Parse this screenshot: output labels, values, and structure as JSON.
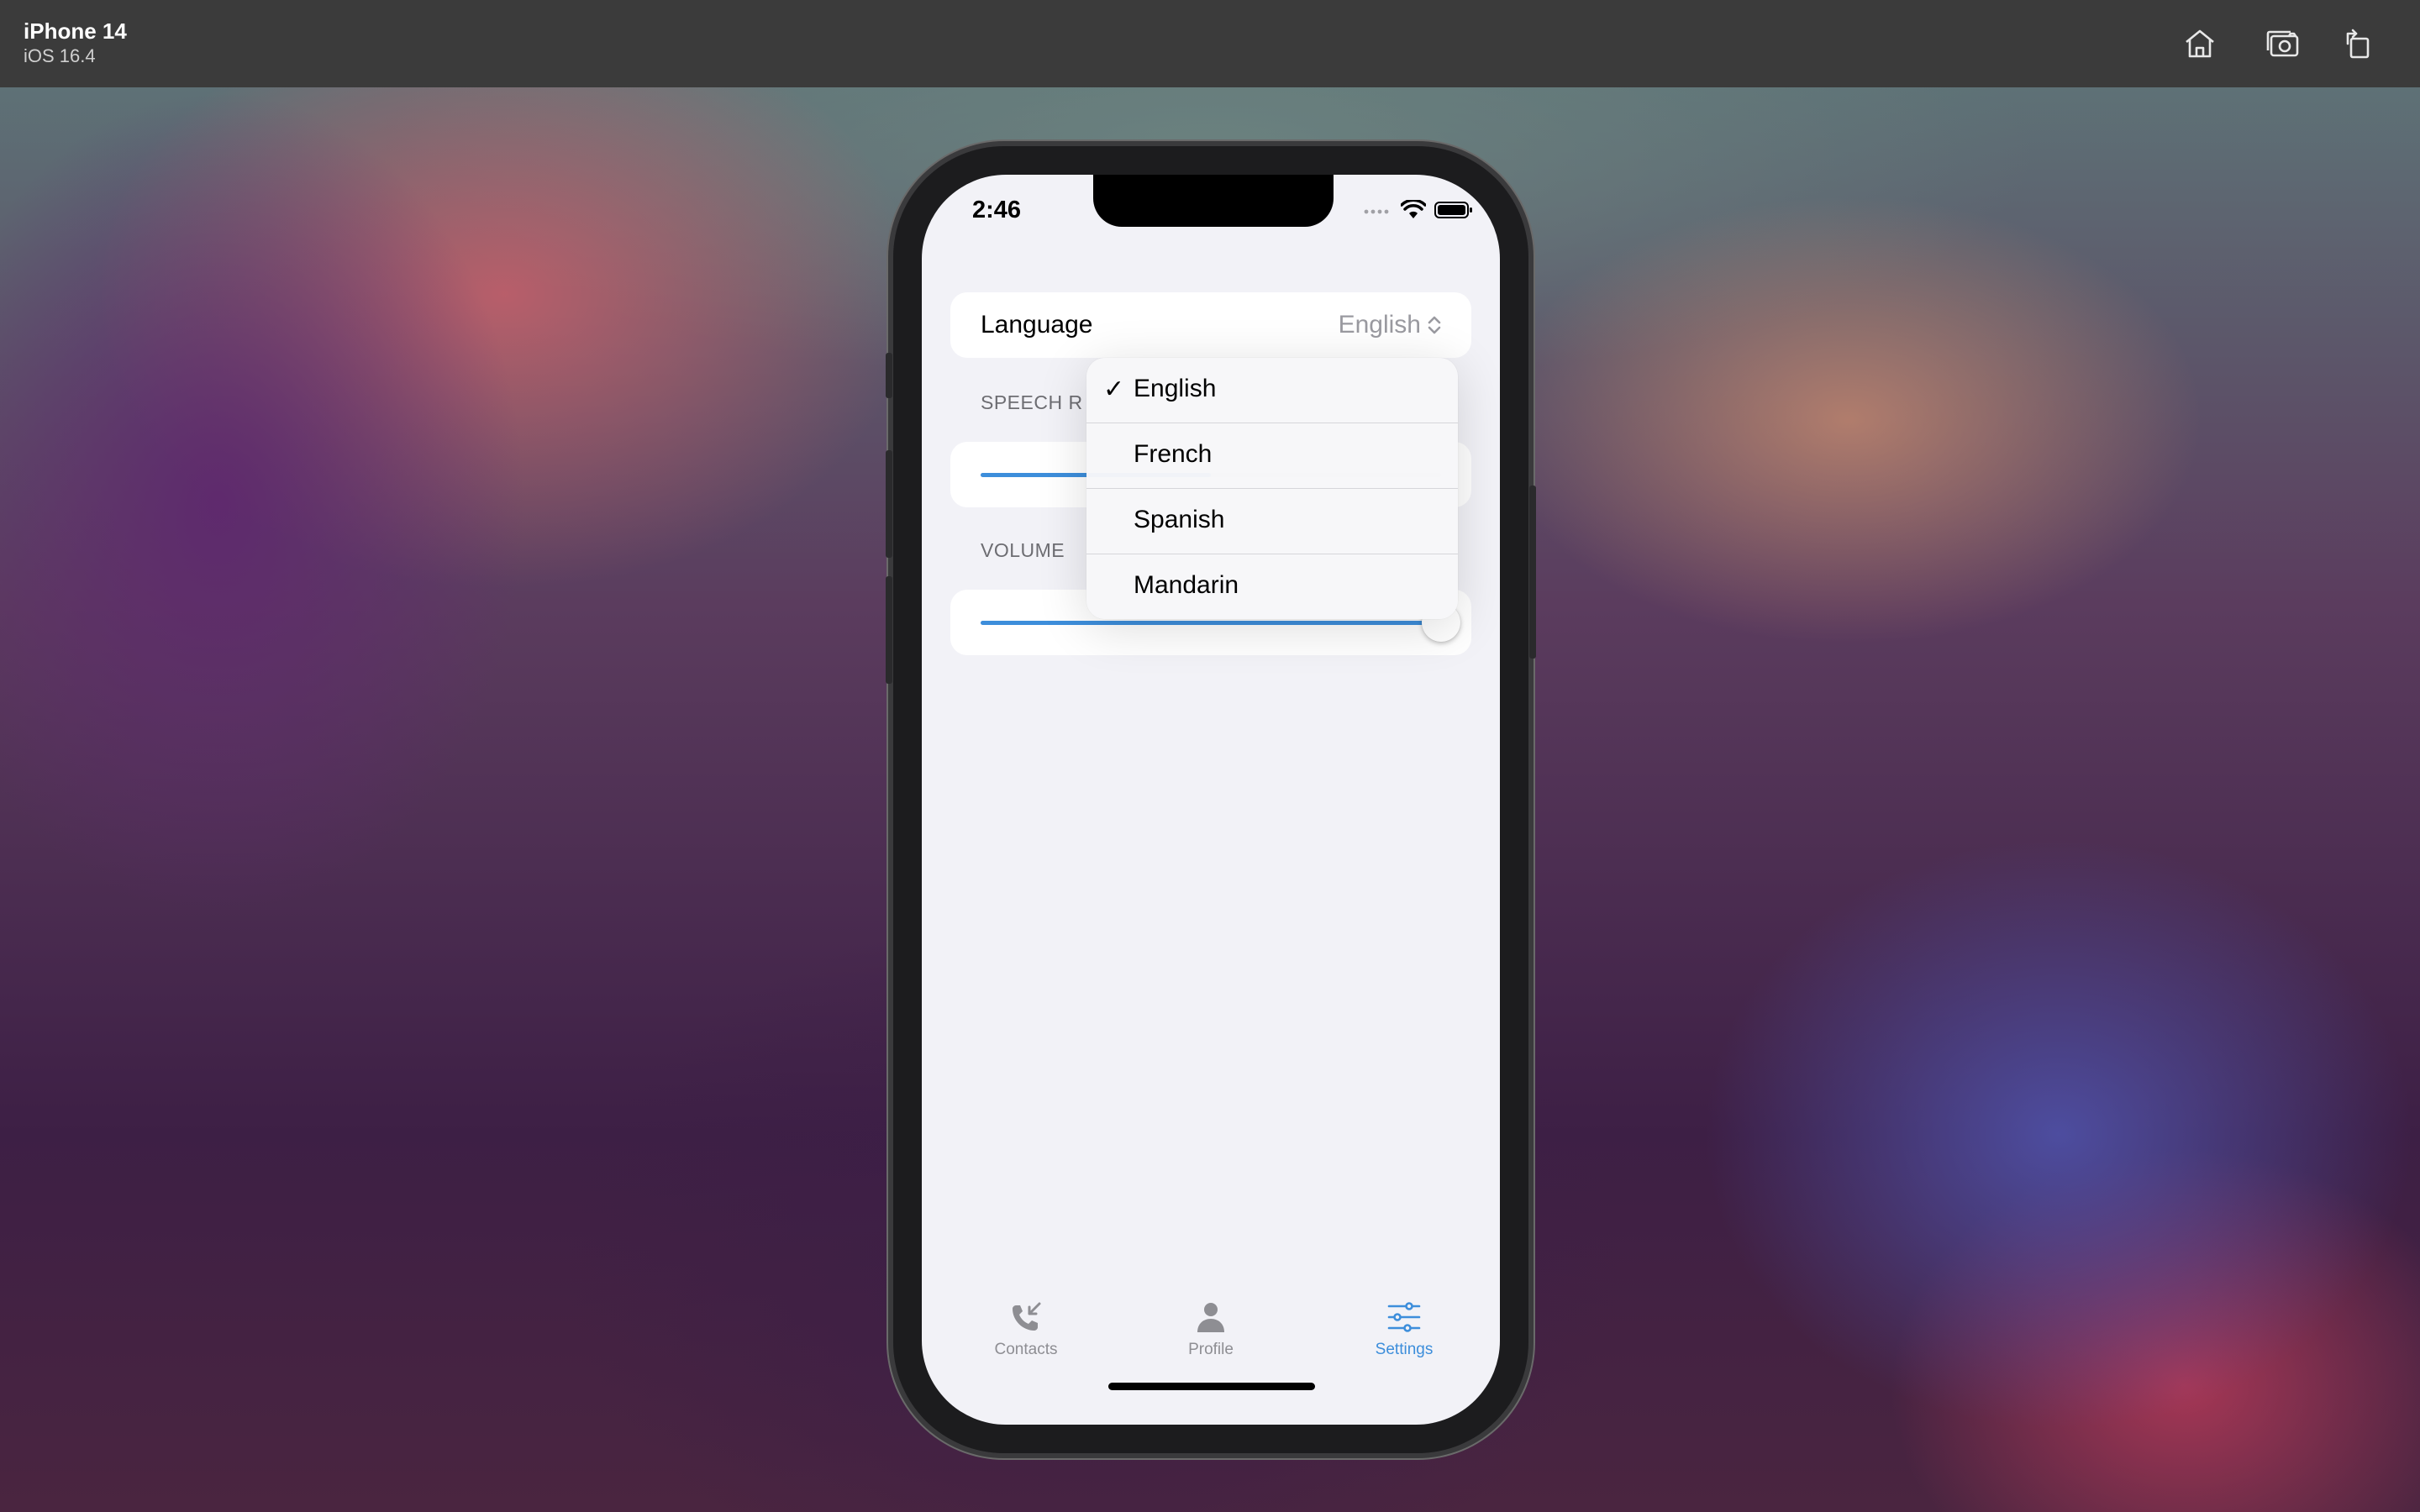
{
  "simulator": {
    "device_name": "iPhone 14",
    "os_version": "iOS 16.4",
    "toolbar_icons": [
      "home-icon",
      "screenshot-icon",
      "rotate-icon"
    ]
  },
  "status_bar": {
    "time": "2:46",
    "icons": [
      "signal-icon",
      "wifi-icon",
      "battery-icon"
    ]
  },
  "settings": {
    "language": {
      "label": "Language",
      "value": "English"
    },
    "speech_rate": {
      "header": "SPEECH R",
      "value_fraction": 0.5
    },
    "volume": {
      "header": "VOLUME",
      "value_fraction": 1.0
    }
  },
  "language_menu": {
    "selected": "English",
    "options": [
      {
        "label": "English",
        "checked": true
      },
      {
        "label": "French",
        "checked": false
      },
      {
        "label": "Spanish",
        "checked": false
      },
      {
        "label": "Mandarin",
        "checked": false
      }
    ],
    "checkmark": "✓"
  },
  "tabbar": {
    "tabs": [
      {
        "label": "Contacts",
        "icon": "phone-incoming-icon",
        "active": false
      },
      {
        "label": "Profile",
        "icon": "person-icon",
        "active": false
      },
      {
        "label": "Settings",
        "icon": "sliders-icon",
        "active": true
      }
    ],
    "active_color": "#3d8edb",
    "inactive_color": "#8e8e93"
  }
}
